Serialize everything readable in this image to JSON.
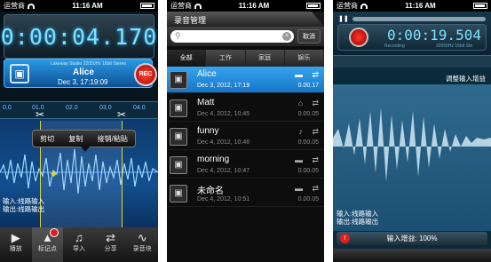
{
  "status": {
    "carrier": "运营商",
    "time": "11:16 AM"
  },
  "rec_screen": {
    "timer": "0:00:04.170",
    "card": {
      "meta": "Lakeway Studio 22050Hz 16bit Stereo",
      "name": "Alice",
      "date": "Dec 3, 17:19:09"
    },
    "rec_label": "REC",
    "ruler": [
      "0.0",
      "01.0",
      "02.0",
      "03.0",
      "04.0"
    ],
    "popup": {
      "cut": "剪切",
      "copy": "复制",
      "paste": "接销/粘贴"
    },
    "io": {
      "input": "输入:线路输入",
      "output": "输出:线路输出"
    },
    "tabs": [
      {
        "label": "播放",
        "icon": "play-icon"
      },
      {
        "label": "标记点",
        "icon": "warning-icon"
      },
      {
        "label": "导入",
        "icon": "music-note-icon"
      },
      {
        "label": "分享",
        "icon": "share-icon"
      },
      {
        "label": "录音块",
        "icon": "waveform-icon"
      }
    ]
  },
  "list_screen": {
    "title": "录音管理",
    "search_placeholder": "",
    "cancel": "取消",
    "segments": [
      "全部",
      "工作",
      "家庭",
      "娱乐"
    ],
    "recordings": [
      {
        "name": "Alice",
        "date": "Dec 3, 2012, 17:19",
        "duration": "0.00.17",
        "category": "work-icon"
      },
      {
        "name": "Matt",
        "date": "Dec 4, 2012, 10:45",
        "duration": "0.00.05",
        "category": "home-icon"
      },
      {
        "name": "funny",
        "date": "Dec 4, 2012, 10:46",
        "duration": "0.00.05",
        "category": "entertainment-icon"
      },
      {
        "name": "morning",
        "date": "Dec 4, 2012, 10:47",
        "duration": "0.00.05",
        "category": "work-icon"
      },
      {
        "name": "未命名",
        "date": "Dec 4, 2012, 10:51",
        "duration": "0.00.05",
        "category": "work-icon"
      }
    ]
  },
  "gain_screen": {
    "timer": "0:00:19.504",
    "rec_small": "Recording",
    "format_small": "22050Hz 16bit Ste",
    "adjust": "调整输入增益",
    "io": {
      "input": "输入:线路输入",
      "output": "输出:线路输出"
    },
    "gain": "输入增益: 100%",
    "gain_level": 1.0
  },
  "colors": {
    "accent": "#2a9ae6",
    "rec": "#e02020",
    "timer": "#7fe1ff"
  }
}
